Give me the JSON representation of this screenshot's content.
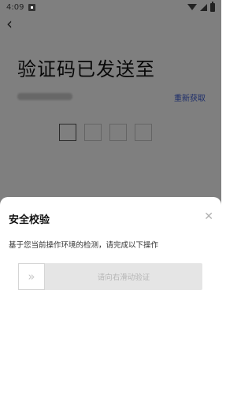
{
  "status_bar": {
    "time": "4:09"
  },
  "page": {
    "title": "验证码已发送至",
    "refresh_label": "重新获取",
    "code_box_count": 4
  },
  "sheet": {
    "title": "安全校验",
    "description": "基于您当前操作环境的检测，请完成以下操作",
    "slider_label": "请向右滑动验证",
    "close_icon": "close-icon",
    "slider_icon": "chevrons-right-icon"
  }
}
